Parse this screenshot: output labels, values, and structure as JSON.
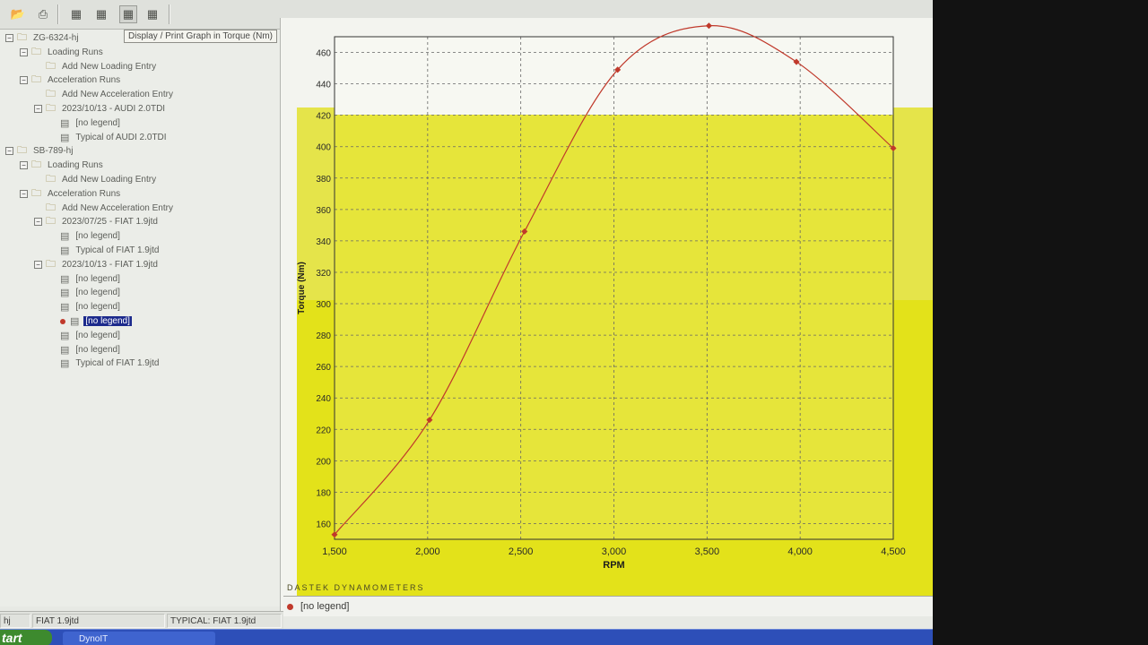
{
  "toolbar": {
    "icons": [
      "folder-open-icon",
      "print-icon",
      "graph-icon",
      "graph-icon",
      "graph-select-icon",
      "graph-icon"
    ]
  },
  "tooltip": "Display / Print Graph in Torque (Nm)",
  "tree": [
    {
      "label": "ZG-6324-hj",
      "icon": "folder-icon",
      "expander": "−",
      "indent": 0
    },
    {
      "label": "Loading Runs",
      "icon": "folder-icon",
      "expander": "−",
      "indent": 1
    },
    {
      "label": "Add New Loading Entry",
      "icon": "folder-icon",
      "expander": "",
      "indent": 2
    },
    {
      "label": "Acceleration Runs",
      "icon": "folder-icon",
      "expander": "−",
      "indent": 1
    },
    {
      "label": "Add New Acceleration Entry",
      "icon": "folder-icon",
      "expander": "",
      "indent": 2
    },
    {
      "label": "2023/10/13 - AUDI 2.0TDI",
      "icon": "folder-icon",
      "expander": "−",
      "indent": 2
    },
    {
      "label": "[no legend]",
      "icon": "run-doc-icon",
      "expander": "",
      "indent": 3
    },
    {
      "label": "Typical of AUDI 2.0TDI",
      "icon": "typical-doc-icon",
      "expander": "",
      "indent": 3
    },
    {
      "label": "SB-789-hj",
      "icon": "folder-icon",
      "expander": "−",
      "indent": 0
    },
    {
      "label": "Loading Runs",
      "icon": "folder-icon",
      "expander": "−",
      "indent": 1
    },
    {
      "label": "Add New Loading Entry",
      "icon": "folder-icon",
      "expander": "",
      "indent": 2
    },
    {
      "label": "Acceleration Runs",
      "icon": "folder-icon",
      "expander": "−",
      "indent": 1
    },
    {
      "label": "Add New Acceleration Entry",
      "icon": "folder-icon",
      "expander": "",
      "indent": 2
    },
    {
      "label": "2023/07/25 - FIAT 1.9jtd",
      "icon": "folder-icon",
      "expander": "−",
      "indent": 2
    },
    {
      "label": "[no legend]",
      "icon": "run-doc-icon",
      "expander": "",
      "indent": 3
    },
    {
      "label": "Typical of FIAT 1.9jtd",
      "icon": "typical-doc-icon",
      "expander": "",
      "indent": 3
    },
    {
      "label": "2023/10/13 - FIAT 1.9jtd",
      "icon": "folder-icon",
      "expander": "−",
      "indent": 2
    },
    {
      "label": "[no legend]",
      "icon": "run-doc-icon",
      "expander": "",
      "indent": 3
    },
    {
      "label": "[no legend]",
      "icon": "run-doc-icon",
      "expander": "",
      "indent": 3
    },
    {
      "label": "[no legend]",
      "icon": "run-doc-icon",
      "expander": "",
      "indent": 3
    },
    {
      "label": "[no legend]",
      "icon": "run-doc-icon",
      "expander": "",
      "indent": 3,
      "selected": true
    },
    {
      "label": "[no legend]",
      "icon": "run-doc-icon",
      "expander": "",
      "indent": 3
    },
    {
      "label": "[no legend]",
      "icon": "run-doc-icon",
      "expander": "",
      "indent": 3
    },
    {
      "label": "Typical of FIAT 1.9jtd",
      "icon": "typical-doc-icon",
      "expander": "",
      "indent": 3
    }
  ],
  "chart_data": {
    "type": "line",
    "xlabel": "RPM",
    "ylabel": "Torque (Nm)",
    "xlim": [
      1500,
      4500
    ],
    "ylim": [
      150,
      470
    ],
    "xticks": [
      1500,
      2000,
      2500,
      3000,
      3500,
      4000,
      4500
    ],
    "xtick_labels": [
      "1,500",
      "2,000",
      "2,500",
      "3,000",
      "3,500",
      "4,000",
      "4,500"
    ],
    "yticks": [
      160,
      180,
      200,
      220,
      240,
      260,
      280,
      300,
      320,
      340,
      360,
      380,
      400,
      420,
      440,
      460
    ],
    "grid": true,
    "series": [
      {
        "name": "[no legend]",
        "color": "#c0392b",
        "x": [
          1500,
          2010,
          2520,
          3020,
          3510,
          3980,
          4500
        ],
        "y": [
          153,
          226,
          346,
          449,
          477,
          454,
          399
        ]
      }
    ],
    "background": "#e3e21a",
    "brand": "DASTEK DYNAMOMETERS"
  },
  "legend": {
    "label": "[no legend]"
  },
  "status": {
    "cell1": "hj",
    "cell2": "FIAT 1.9jtd",
    "cell3": "TYPICAL: FIAT 1.9jtd"
  },
  "taskbar": {
    "start": "tart",
    "task": "DynoIT"
  }
}
